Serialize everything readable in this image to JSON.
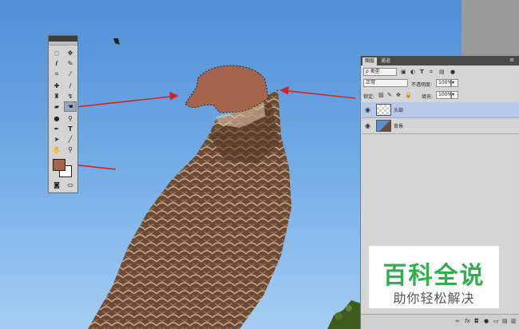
{
  "tools_panel": {
    "tools": [
      "marquee-icon",
      "move-icon",
      "lasso-icon",
      "quick-select-icon",
      "crop-icon",
      "eyedropper-icon",
      "healing-icon",
      "brush-icon",
      "stamp-icon",
      "history-brush-icon",
      "eraser-icon",
      "fill-hand-icon",
      "blur-icon",
      "dodge-icon",
      "pen-icon",
      "text-icon",
      "path-select-icon",
      "line-icon",
      "hand-icon",
      "zoom-icon"
    ],
    "text_tool_glyph": "T",
    "foreground_color": "#a5654c",
    "background_color": "#ffffff"
  },
  "layers_panel": {
    "tabs": [
      "图层",
      "通道"
    ],
    "kind_filter": "ρ 类型",
    "blend_mode": "正常",
    "opacity_label": "不透明度:",
    "opacity_value": "100%",
    "lock_label": "锁定:",
    "fill_label": "填充:",
    "fill_value": "100%",
    "layers": [
      {
        "name": "头部",
        "selected": true
      },
      {
        "name": "背景",
        "selected": false
      }
    ],
    "footer_icons": [
      "∞",
      "fx",
      "◘",
      "●",
      "▭",
      "▤",
      "🗑"
    ]
  },
  "watermark": {
    "title": "百科全说",
    "subtitle": "助你轻松解决",
    "title_color": "#2fb04c"
  },
  "annotation_color": "#d62020"
}
